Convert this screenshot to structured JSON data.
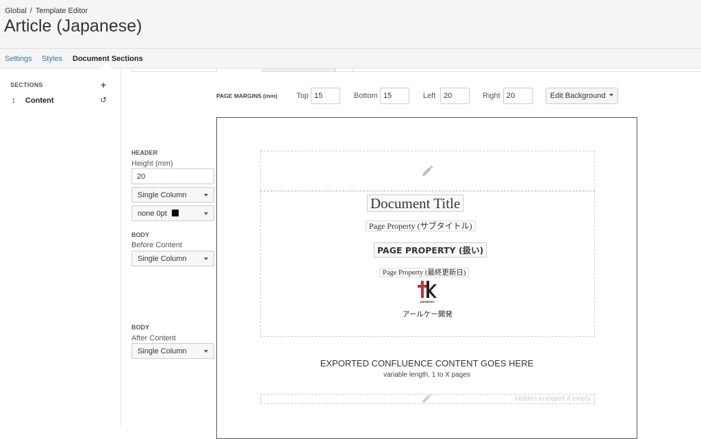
{
  "breadcrumb": {
    "root": "Global",
    "separator": "/",
    "current": "Template Editor"
  },
  "page_title": "Article (Japanese)",
  "tabs": [
    {
      "label": "Settings",
      "active": false
    },
    {
      "label": "Styles",
      "active": false
    },
    {
      "label": "Document Sections",
      "active": true
    }
  ],
  "sidebar": {
    "sections_label": "SECTIONS",
    "add_icon": "plus-icon",
    "items": [
      {
        "label": "Content",
        "drag_icon": "drag-handle-icon",
        "reset_icon": "reset-icon"
      }
    ]
  },
  "page_margins": {
    "label": "PAGE MARGINS (mm)",
    "top_label": "Top",
    "top_value": "15",
    "bottom_label": "Bottom",
    "bottom_value": "15",
    "left_label": "Left",
    "left_value": "20",
    "right_label": "Right",
    "right_value": "20",
    "edit_background_label": "Edit Background"
  },
  "header_controls": {
    "label": "HEADER",
    "height_label": "Height (mm)",
    "height_value": "20",
    "column_select": "Single Column",
    "border_select": "none 0pt",
    "border_color": "#000000"
  },
  "body_before": {
    "label": "BODY",
    "sub_label": "Before Content",
    "column_select": "Single Column"
  },
  "body_after": {
    "label": "BODY",
    "sub_label": "After Content",
    "column_select": "Single Column"
  },
  "canvas": {
    "document_title": "Document Title",
    "subtitle_property": "Page Property (サブタイトル)",
    "handling_property": "PAGE PROPERTY (扱い)",
    "updated_property": "Page Property (最終更新日)",
    "logo_caption": "KAIHATSU",
    "company_name": "アールケー開発",
    "exported_title": "EXPORTED CONFLUENCE CONTENT GOES HERE",
    "exported_sub": "variable length, 1 to X pages",
    "footer_hidden_note": "Hidden in export if empty"
  },
  "colors": {
    "link": "#3572b0",
    "logo_red": "#d42a2a",
    "logo_dark": "#222222"
  }
}
